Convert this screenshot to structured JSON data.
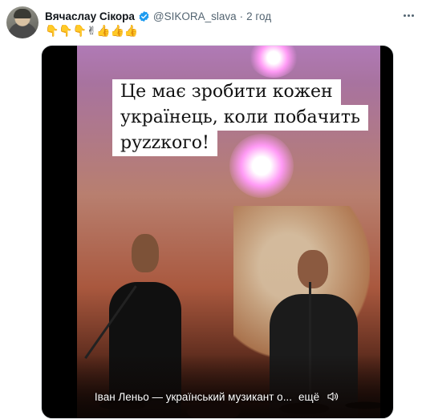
{
  "tweet": {
    "author_name": "Вячаслау Сікора",
    "handle": "@SIKORA_slava",
    "separator": "·",
    "time": "2 год",
    "text": "👇👇👇✌👍👍👍"
  },
  "media": {
    "overlay_caption": [
      "Це має зробити кожен",
      "українець, коли побачить",
      "руzzкого!"
    ],
    "subtitle": "Іван Леньо — український музикант о...",
    "more_label": "ещё",
    "volume_icon": "volume-icon"
  },
  "colors": {
    "verified": "#1d9bf0",
    "muted_text": "#536471"
  }
}
